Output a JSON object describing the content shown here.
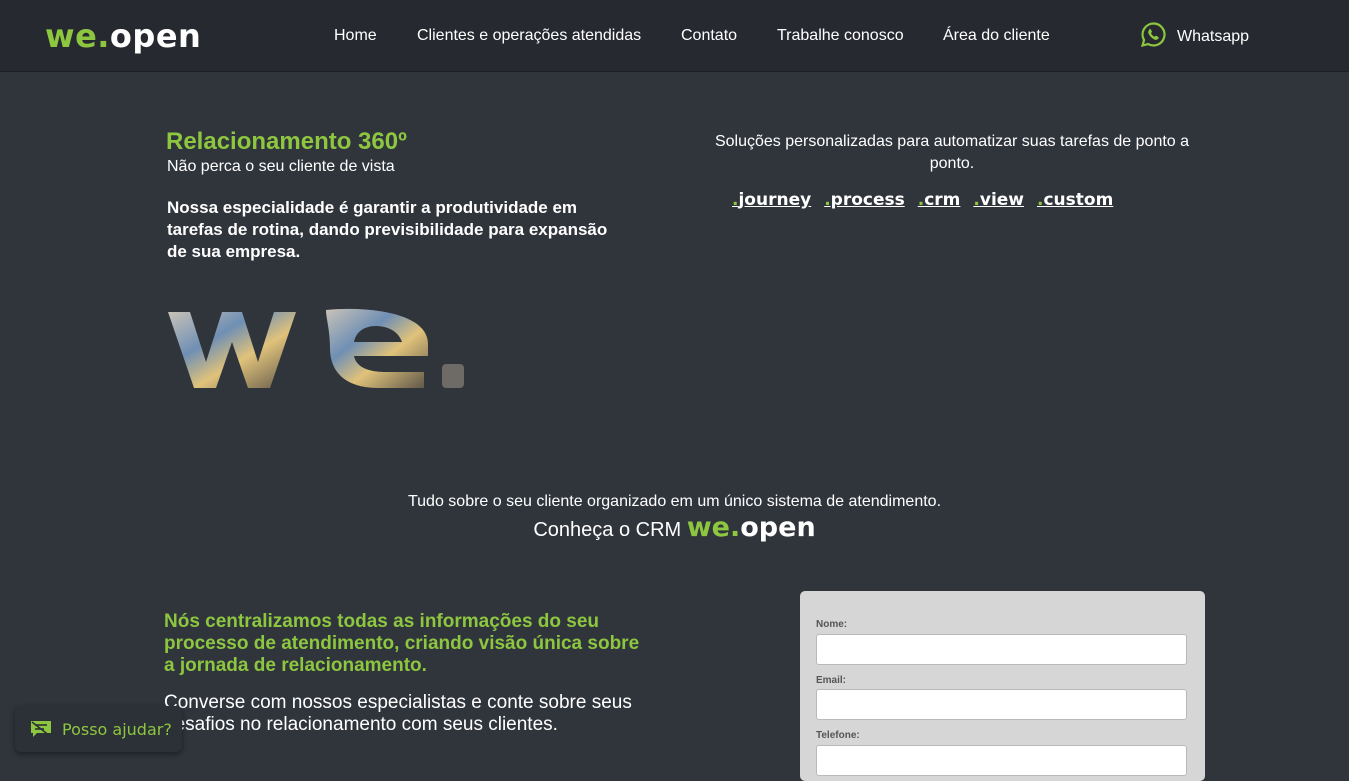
{
  "header": {
    "logo": {
      "we": "we.",
      "open": "open"
    },
    "nav": [
      "Home",
      "Clientes e operações atendidas",
      "Contato",
      "Trabalhe conosco",
      "Área do cliente"
    ],
    "whatsapp": {
      "label": "Whatsapp",
      "icon": "whatsapp-icon"
    }
  },
  "hero": {
    "title": "Relacionamento 360º",
    "subtitle": "Não perca o seu cliente de vista",
    "description": "Nossa especialidade é garantir a produtividade em tarefas de rotina, dando previsibilidade para expansão de sua empresa.",
    "intro": "Soluções personalizadas para automatizar suas tarefas de ponto a ponto.",
    "products": [
      ".journey",
      ".process",
      ".crm",
      ".view",
      ".custom"
    ]
  },
  "crm_cta": {
    "line1": "Tudo sobre o seu cliente organizado em um único sistema de atendimento.",
    "line2": "Conheça o CRM",
    "logo_we": "we.",
    "logo_open": "open"
  },
  "info": {
    "green_text": "Nós centralizamos todas as informações do seu processo de atendimento, criando visão única sobre a jornada de relacionamento.",
    "white_text": "Converse com nossos especialistas e conte sobre seus desafios no relacionamento com seus clientes."
  },
  "form": {
    "name_label": "Nome:",
    "email_label": "Email:",
    "phone_label": "Telefone:"
  },
  "chat_widget": {
    "label": "Posso ajudar?",
    "icon": "chat-icon"
  },
  "colors": {
    "accent": "#8dc63f",
    "background": "#30353c",
    "header": "#262a30"
  }
}
